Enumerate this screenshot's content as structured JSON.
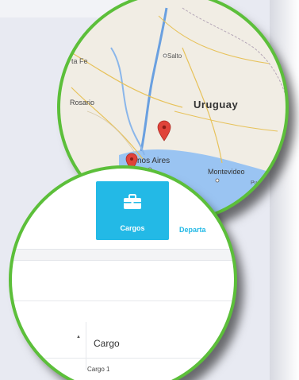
{
  "map": {
    "labels": {
      "santa_fe": "ta Fe",
      "salto": "Salto",
      "rosario": "Rosario",
      "uruguay": "Uruguay",
      "buenos_aires": "nos Aires",
      "montevideo": "Montevideo",
      "punta_del_este": "Punta del E"
    }
  },
  "cards": {
    "cargos_label": "Cargos",
    "departamentos_label": "Departa"
  },
  "table": {
    "sort_glyph": "▲",
    "column_cargo": "Cargo",
    "rows": [
      {
        "cargo": "Cargo 1"
      }
    ]
  },
  "colors": {
    "accent": "#23b9e6",
    "ring": "#5cbf3a",
    "water": "#9ac4f2",
    "map_land": "#f1ede4",
    "pin": "#e0433a"
  }
}
